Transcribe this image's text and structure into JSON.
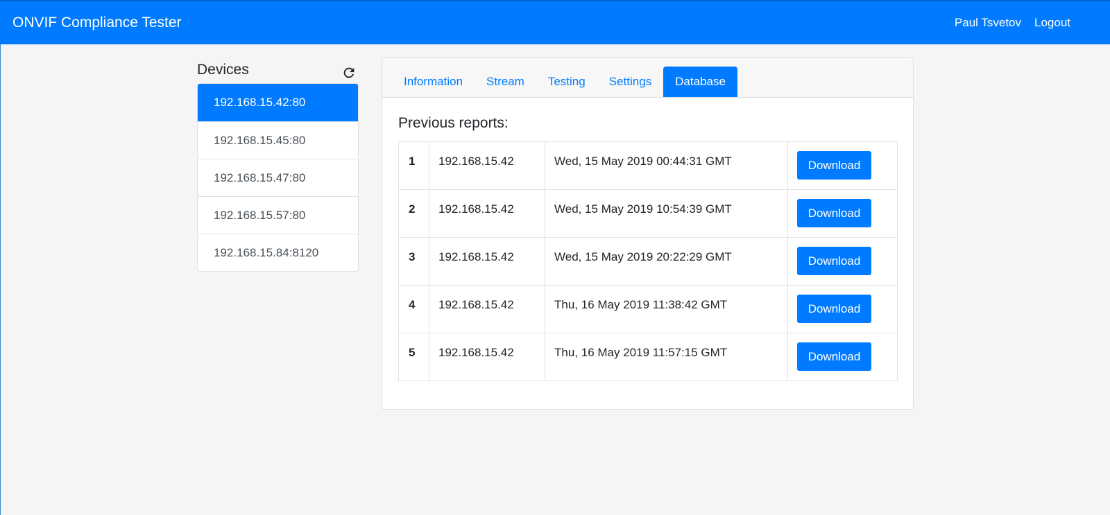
{
  "header": {
    "brand": "ONVIF Compliance Tester",
    "user": "Paul Tsvetov",
    "logout": "Logout"
  },
  "sidebar": {
    "title": "Devices",
    "refresh_icon": "refresh-icon",
    "devices": [
      "192.168.15.42:80",
      "192.168.15.45:80",
      "192.168.15.47:80",
      "192.168.15.57:80",
      "192.168.15.84:8120"
    ],
    "active_index": 0
  },
  "tabs": [
    "Information",
    "Stream",
    "Testing",
    "Settings",
    "Database"
  ],
  "active_tab": "Database",
  "main": {
    "section_title": "Previous reports:",
    "download_label": "Download",
    "rows": [
      {
        "num": "1",
        "ip": "192.168.15.42",
        "date": "Wed, 15 May 2019 00:44:31 GMT"
      },
      {
        "num": "2",
        "ip": "192.168.15.42",
        "date": "Wed, 15 May 2019 10:54:39 GMT"
      },
      {
        "num": "3",
        "ip": "192.168.15.42",
        "date": "Wed, 15 May 2019 20:22:29 GMT"
      },
      {
        "num": "4",
        "ip": "192.168.15.42",
        "date": "Thu, 16 May 2019 11:38:42 GMT"
      },
      {
        "num": "5",
        "ip": "192.168.15.42",
        "date": "Thu, 16 May 2019 11:57:15 GMT"
      }
    ]
  },
  "colors": {
    "primary": "#007bff",
    "background": "#f5f5f5"
  }
}
